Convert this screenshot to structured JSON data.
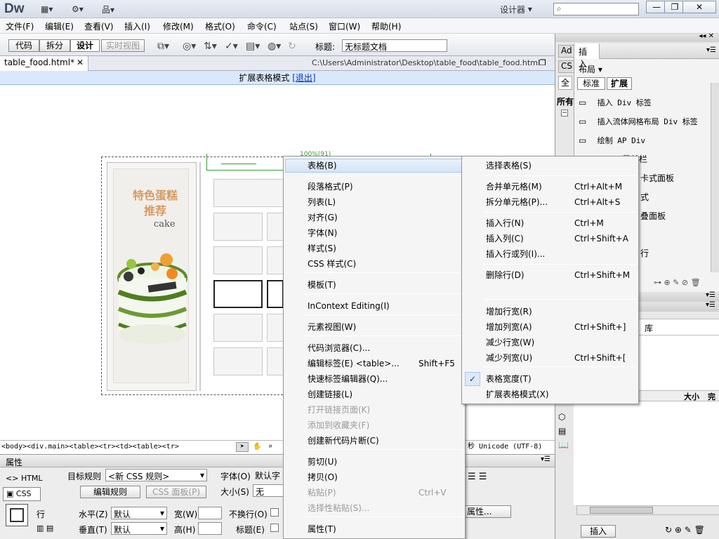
{
  "app": {
    "logo": "Dw",
    "designer": "设计器"
  },
  "menubar": [
    "文件(F)",
    "编辑(E)",
    "查看(V)",
    "插入(I)",
    "修改(M)",
    "格式(O)",
    "命令(C)",
    "站点(S)",
    "窗口(W)",
    "帮助(H)"
  ],
  "doc_toolbar": {
    "code": "代码",
    "split": "拆分",
    "design": "设计",
    "live_view": "实时视图",
    "title_label": "标题:",
    "title_value": "无标题文档"
  },
  "doc_tab": {
    "name": "table_food.html*",
    "path": "C:\\Users\\Administrator\\Desktop\\table_food\\table_food.html"
  },
  "expanded_mode": {
    "text": "扩展表格模式",
    "exit": "[退出]"
  },
  "canvas": {
    "heading": "特色蛋糕\n推荐",
    "sub": "cake",
    "green_label": "100%(91)"
  },
  "tag_selector": "<body><div.main><table><tr><td><table><tr>",
  "status": {
    "encoding": "秒  Unicode (UTF-8)"
  },
  "properties": {
    "title": "属性",
    "html": "HTML",
    "css": "CSS",
    "target_rule_label": "目标规则",
    "target_rule_value": "<新 CSS 规则>",
    "edit_rule": "编辑规则",
    "css_panel": "CSS 面板(P)",
    "font_label": "字体(O)",
    "font_value": "默认字",
    "size_label": "大小(S)",
    "size_value": "无",
    "row_label": "行",
    "horz_label": "水平(Z)",
    "horz_value": "默认",
    "vert_label": "垂直(T)",
    "vert_value": "默认",
    "width_label": "宽(W)",
    "height_label": "高(H)",
    "nowrap_label": "不换行(O)",
    "header_label": "标题(E)",
    "page_props": "属性..."
  },
  "insert_panel": {
    "tabs": [
      "Ad",
      "CS"
    ],
    "all": "全",
    "all2": "所有",
    "title": "插入",
    "category": "布局",
    "tab_std": "标准",
    "tab_ext": "扩展",
    "items": [
      "插入 Div 标签",
      "插入流体网格布局 Div 标签",
      "绘制 AP Div"
    ],
    "partial": [
      "菜单栏",
      "卡式面板",
      "式",
      "叠面板",
      "行"
    ],
    "library": "库",
    "col_size": "大小",
    "col_done": "完",
    "insert_btn": "插入"
  },
  "context_menu": [
    {
      "label": "表格(B)",
      "sub": true,
      "highlight": true
    },
    {
      "label": "段落格式(P)",
      "sub": true
    },
    {
      "label": "列表(L)",
      "sub": true
    },
    {
      "label": "对齐(G)",
      "sub": true
    },
    {
      "label": "字体(N)",
      "sub": true
    },
    {
      "label": "样式(S)",
      "sub": true
    },
    {
      "label": "CSS 样式(C)",
      "sub": true
    },
    {
      "label": "模板(T)",
      "sub": true
    },
    {
      "label": "InContext Editing(I)",
      "sub": true
    },
    {
      "label": "元素视图(W)",
      "sub": true
    },
    {
      "label": "代码浏览器(C)..."
    },
    {
      "label": "编辑标签(E) <table>...",
      "shortcut": "Shift+F5"
    },
    {
      "label": "快速标签编辑器(Q)..."
    },
    {
      "label": "创建链接(L)"
    },
    {
      "label": "打开链接页面(K)",
      "disabled": true
    },
    {
      "label": "添加到收藏夹(F)",
      "disabled": true
    },
    {
      "label": "创建新代码片断(C)"
    },
    {
      "label": "剪切(U)"
    },
    {
      "label": "拷贝(O)"
    },
    {
      "label": "粘贴(P)",
      "shortcut": "Ctrl+V",
      "disabled": true
    },
    {
      "label": "选择性粘贴(S)...",
      "disabled": true
    },
    {
      "label": "属性(T)"
    }
  ],
  "table_submenu": [
    {
      "label": "选择表格(S)"
    },
    {
      "label": "合并单元格(M)",
      "shortcut": "Ctrl+Alt+M"
    },
    {
      "label": "拆分单元格(P)...",
      "shortcut": "Ctrl+Alt+S"
    },
    {
      "label": "插入行(N)",
      "shortcut": "Ctrl+M"
    },
    {
      "label": "插入列(C)",
      "shortcut": "Ctrl+Shift+A"
    },
    {
      "label": "插入行或列(I)..."
    },
    {
      "label": "删除行(D)",
      "shortcut": "Ctrl+Shift+M"
    },
    {
      "label": "增加行宽(R)"
    },
    {
      "label": "增加列宽(A)",
      "shortcut": "Ctrl+Shift+]"
    },
    {
      "label": "减少行宽(W)"
    },
    {
      "label": "减少列宽(U)",
      "shortcut": "Ctrl+Shift+["
    },
    {
      "label": "表格宽度(T)",
      "checked": true
    },
    {
      "label": "扩展表格模式(X)"
    }
  ]
}
